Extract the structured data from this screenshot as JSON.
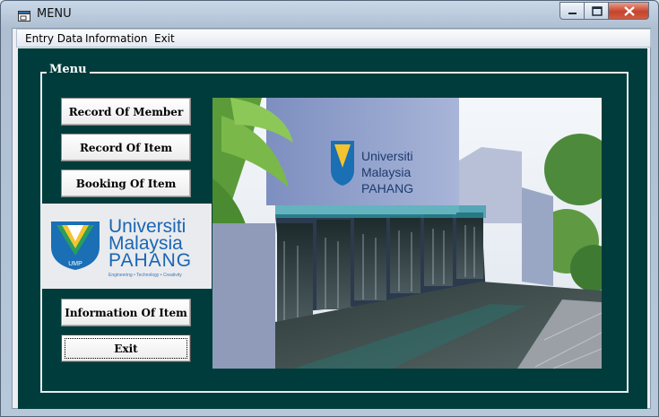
{
  "window": {
    "title": "MENU"
  },
  "menubar": {
    "items": [
      "Entry Data",
      "Information",
      "Exit"
    ]
  },
  "frame": {
    "legend": "Menu"
  },
  "buttons": {
    "record_member": "Record Of Member",
    "record_item": "Record Of Item",
    "booking_item": "Booking Of Item",
    "information_item": "Information Of Item",
    "exit": "Exit"
  },
  "logo": {
    "line1": "Universiti",
    "line2": "Malaysia",
    "line3": "PAHANG",
    "tagline": "Engineering • Technology • Creativity",
    "badge": "UMP"
  },
  "photo_sign": {
    "line1": "Universiti",
    "line2": "Malaysia",
    "line3": "PAHANG"
  },
  "colors": {
    "background": "#003c3c",
    "frame_border": "#e8ecef",
    "brand_blue": "#1a66b3"
  }
}
